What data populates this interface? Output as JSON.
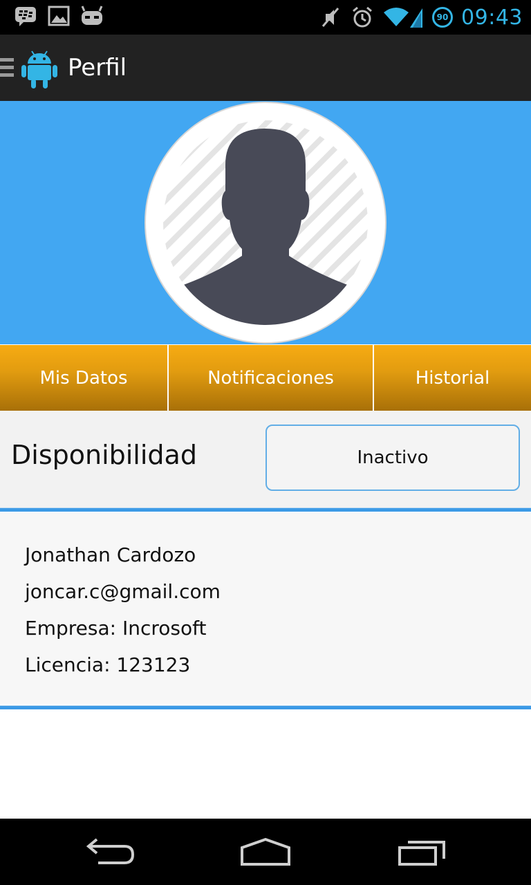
{
  "status_bar": {
    "time": "09:43",
    "battery_level": "90",
    "icons": [
      "bbm-icon",
      "gallery-icon",
      "cyanogen-icon",
      "mute-icon",
      "alarm-icon",
      "wifi-icon",
      "signal-icon",
      "battery-icon"
    ],
    "accent": "#33b5e5"
  },
  "action_bar": {
    "title": "Perfil",
    "icons": [
      "menu-icon",
      "android-logo-icon"
    ]
  },
  "header": {
    "background": "#42a7f2",
    "avatar": "profile-placeholder-icon"
  },
  "tabs": [
    {
      "label": "Mis Datos"
    },
    {
      "label": "Notificaciones"
    },
    {
      "label": "Historial"
    }
  ],
  "availability": {
    "label": "Disponibilidad",
    "status": "Inactivo"
  },
  "profile": {
    "name": "Jonathan Cardozo",
    "email": "joncar.c@gmail.com",
    "company": "Empresa: Incrosoft",
    "license": "Licencia: 123123"
  },
  "nav_bar": {
    "icons": [
      "back-icon",
      "home-icon",
      "recents-icon"
    ]
  }
}
